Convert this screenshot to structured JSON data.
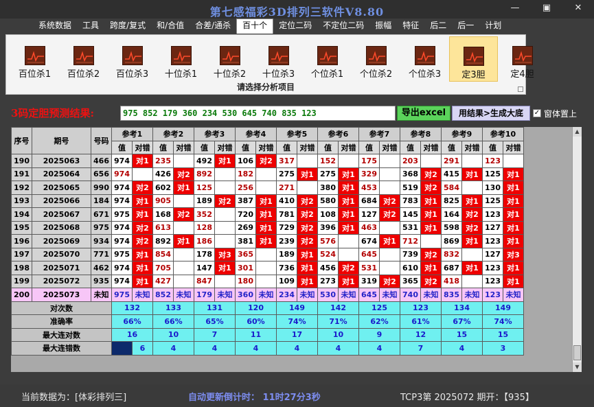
{
  "window": {
    "title": "第七感福彩3D排列三软件V8.80",
    "minimize": "—",
    "maximize": "▣",
    "close": "✕"
  },
  "menu": [
    "系统数据",
    "工具",
    "跨度/复式",
    "和/合值",
    "合差/通杀",
    "百十个",
    "定位二码",
    "不定位二码",
    "振幅",
    "特征",
    "后二",
    "后一",
    "计划"
  ],
  "menu_active": 5,
  "toolbar": {
    "items": [
      "百位杀1",
      "百位杀2",
      "百位杀3",
      "十位杀1",
      "十位杀2",
      "十位杀3",
      "个位杀1",
      "个位杀2",
      "个位杀3",
      "定3胆",
      "定4胆"
    ],
    "selected": 9,
    "caption": "请选择分析项目"
  },
  "prediction": {
    "label": "3码定胆预测结果:",
    "value": "975 852 179 360 234 530 645 740 835 123",
    "export_button": "导出excel",
    "generate_button": "用结果>生成大底",
    "topmost_label": "窗体置上",
    "topmost_checked": "✓"
  },
  "table": {
    "col_headers": [
      "序号",
      "期号",
      "号码"
    ],
    "ref_headers": [
      "参考1",
      "参考2",
      "参考3",
      "参考4",
      "参考5",
      "参考6",
      "参考7",
      "参考8",
      "参考9",
      "参考10"
    ],
    "sub_value": "值",
    "sub_result": "对错",
    "rows": [
      {
        "seq": "190",
        "period": "2025063",
        "num": "466",
        "cells": [
          [
            "974",
            "b",
            "对1"
          ],
          [
            "235",
            "r",
            ""
          ],
          [
            "492",
            "b",
            "对1"
          ],
          [
            "106",
            "b",
            "对2"
          ],
          [
            "317",
            "r",
            ""
          ],
          [
            "152",
            "r",
            ""
          ],
          [
            "175",
            "r",
            ""
          ],
          [
            "203",
            "r",
            ""
          ],
          [
            "291",
            "r",
            ""
          ],
          [
            "123",
            "r",
            ""
          ]
        ]
      },
      {
        "seq": "191",
        "period": "2025064",
        "num": "656",
        "cells": [
          [
            "974",
            "r",
            ""
          ],
          [
            "426",
            "b",
            "对2"
          ],
          [
            "892",
            "r",
            ""
          ],
          [
            "182",
            "r",
            ""
          ],
          [
            "275",
            "b",
            "对1"
          ],
          [
            "275",
            "b",
            "对1"
          ],
          [
            "329",
            "r",
            ""
          ],
          [
            "368",
            "b",
            "对2"
          ],
          [
            "415",
            "b",
            "对1"
          ],
          [
            "125",
            "b",
            "对1"
          ]
        ]
      },
      {
        "seq": "192",
        "period": "2025065",
        "num": "990",
        "cells": [
          [
            "974",
            "b",
            "对2"
          ],
          [
            "602",
            "b",
            "对1"
          ],
          [
            "125",
            "r",
            ""
          ],
          [
            "256",
            "r",
            ""
          ],
          [
            "271",
            "r",
            ""
          ],
          [
            "380",
            "b",
            "对1"
          ],
          [
            "453",
            "r",
            ""
          ],
          [
            "519",
            "b",
            "对2"
          ],
          [
            "584",
            "r",
            ""
          ],
          [
            "130",
            "b",
            "对1"
          ]
        ]
      },
      {
        "seq": "193",
        "period": "2025066",
        "num": "184",
        "cells": [
          [
            "974",
            "b",
            "对1"
          ],
          [
            "905",
            "r",
            ""
          ],
          [
            "189",
            "b",
            "对2"
          ],
          [
            "387",
            "b",
            "对1"
          ],
          [
            "410",
            "b",
            "对2"
          ],
          [
            "580",
            "b",
            "对1"
          ],
          [
            "684",
            "b",
            "对2"
          ],
          [
            "783",
            "b",
            "对1"
          ],
          [
            "825",
            "b",
            "对1"
          ],
          [
            "125",
            "b",
            "对1"
          ]
        ]
      },
      {
        "seq": "194",
        "period": "2025067",
        "num": "671",
        "cells": [
          [
            "975",
            "b",
            "对1"
          ],
          [
            "168",
            "b",
            "对2"
          ],
          [
            "352",
            "r",
            ""
          ],
          [
            "720",
            "b",
            "对1"
          ],
          [
            "781",
            "b",
            "对2"
          ],
          [
            "108",
            "b",
            "对1"
          ],
          [
            "127",
            "b",
            "对2"
          ],
          [
            "145",
            "b",
            "对1"
          ],
          [
            "164",
            "b",
            "对2"
          ],
          [
            "123",
            "b",
            "对1"
          ]
        ]
      },
      {
        "seq": "195",
        "period": "2025068",
        "num": "975",
        "cells": [
          [
            "974",
            "b",
            "对2"
          ],
          [
            "613",
            "r",
            ""
          ],
          [
            "128",
            "r",
            ""
          ],
          [
            "269",
            "b",
            "对1"
          ],
          [
            "729",
            "b",
            "对2"
          ],
          [
            "396",
            "b",
            "对1"
          ],
          [
            "463",
            "r",
            ""
          ],
          [
            "531",
            "b",
            "对1"
          ],
          [
            "598",
            "b",
            "对2"
          ],
          [
            "127",
            "b",
            "对1"
          ]
        ]
      },
      {
        "seq": "196",
        "period": "2025069",
        "num": "934",
        "cells": [
          [
            "974",
            "b",
            "对2"
          ],
          [
            "892",
            "b",
            "对1"
          ],
          [
            "186",
            "r",
            ""
          ],
          [
            "381",
            "b",
            "对1"
          ],
          [
            "239",
            "b",
            "对2"
          ],
          [
            "576",
            "r",
            ""
          ],
          [
            "674",
            "b",
            "对1"
          ],
          [
            "712",
            "r",
            ""
          ],
          [
            "869",
            "b",
            "对1"
          ],
          [
            "123",
            "b",
            "对1"
          ]
        ]
      },
      {
        "seq": "197",
        "period": "2025070",
        "num": "771",
        "cells": [
          [
            "975",
            "b",
            "对1"
          ],
          [
            "854",
            "r",
            ""
          ],
          [
            "178",
            "b",
            "对3"
          ],
          [
            "365",
            "r",
            ""
          ],
          [
            "189",
            "b",
            "对1"
          ],
          [
            "524",
            "r",
            ""
          ],
          [
            "645",
            "r",
            ""
          ],
          [
            "739",
            "b",
            "对2"
          ],
          [
            "832",
            "r",
            ""
          ],
          [
            "127",
            "b",
            "对3"
          ]
        ]
      },
      {
        "seq": "198",
        "period": "2025071",
        "num": "462",
        "cells": [
          [
            "974",
            "b",
            "对1"
          ],
          [
            "705",
            "r",
            ""
          ],
          [
            "147",
            "b",
            "对1"
          ],
          [
            "301",
            "r",
            ""
          ],
          [
            "736",
            "b",
            "对1"
          ],
          [
            "456",
            "b",
            "对2"
          ],
          [
            "531",
            "r",
            ""
          ],
          [
            "610",
            "b",
            "对1"
          ],
          [
            "687",
            "b",
            "对1"
          ],
          [
            "123",
            "b",
            "对1"
          ]
        ]
      },
      {
        "seq": "199",
        "period": "2025072",
        "num": "935",
        "cells": [
          [
            "974",
            "b",
            "对1"
          ],
          [
            "427",
            "r",
            ""
          ],
          [
            "847",
            "r",
            ""
          ],
          [
            "180",
            "r",
            ""
          ],
          [
            "109",
            "b",
            "对1"
          ],
          [
            "273",
            "b",
            "对1"
          ],
          [
            "319",
            "b",
            "对2"
          ],
          [
            "365",
            "b",
            "对2"
          ],
          [
            "418",
            "r",
            ""
          ],
          [
            "123",
            "b",
            "对1"
          ]
        ]
      }
    ],
    "pred_row": {
      "seq": "200",
      "period": "2025073",
      "num": "未知",
      "values": [
        "975",
        "852",
        "179",
        "360",
        "234",
        "530",
        "645",
        "740",
        "835",
        "123"
      ],
      "status": "未知"
    },
    "stats": [
      {
        "label": "对次数",
        "values": [
          "132",
          "133",
          "131",
          "120",
          "149",
          "142",
          "125",
          "123",
          "134",
          "149"
        ],
        "first_navy": false
      },
      {
        "label": "准确率",
        "values": [
          "66%",
          "66%",
          "65%",
          "60%",
          "74%",
          "71%",
          "62%",
          "61%",
          "67%",
          "74%"
        ],
        "first_navy": false
      },
      {
        "label": "最大连对数",
        "values": [
          "16",
          "10",
          "7",
          "11",
          "17",
          "10",
          "9",
          "12",
          "15",
          "15"
        ],
        "first_navy": false
      },
      {
        "label": "最大连错数",
        "values": [
          "6",
          "4",
          "4",
          "4",
          "4",
          "4",
          "4",
          "7",
          "4",
          "3"
        ],
        "first_navy": true
      }
    ]
  },
  "status": {
    "current": "当前数据为：[体彩排列三]",
    "countdown": "自动更新倒计时：  11时27分3秒",
    "latest": "TCP3第 2025072 期开：【935】"
  }
}
